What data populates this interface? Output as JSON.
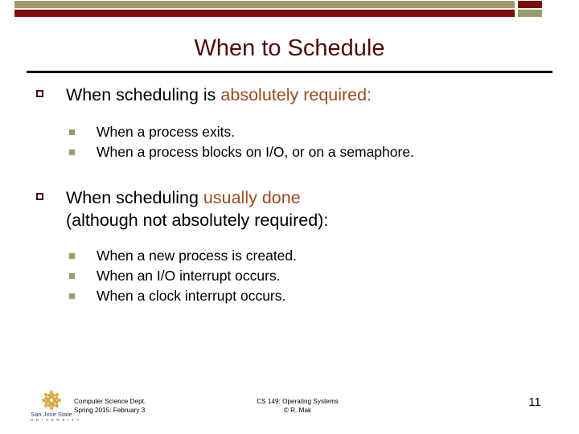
{
  "theme": {
    "banner_olive": "#9a9a6a",
    "banner_maroon": "#7d0c0c",
    "title_color": "#4d0b0b",
    "accent_color": "#9b4a23",
    "bullet1_color": "#4d0b0b",
    "bullet2_color": "#9a9a6a",
    "logo_gold": "#d8a93a",
    "logo_blue": "#1b3a6b"
  },
  "slide": {
    "title": "When to Schedule",
    "blocks": [
      {
        "lead_plain": "When scheduling is ",
        "lead_accent": "absolutely required:",
        "lead_tail": "",
        "sub": [
          "When a process exits.",
          "When a process blocks on I/O, or on a semaphore."
        ]
      },
      {
        "lead_plain": "When scheduling ",
        "lead_accent": "usually done",
        "lead_tail": "(although not absolutely required):",
        "sub": [
          "When a new process is created.",
          "When an I/O interrupt occurs.",
          "When a clock interrupt occurs."
        ]
      }
    ]
  },
  "footer": {
    "logo_name": "San José State",
    "logo_sub": "U N I V E R S I T Y",
    "left_line1": "Computer Science Dept.",
    "left_line2": "Spring 2015: February 3",
    "center_line1": "CS 149: Operating Systems",
    "center_line2": "© R. Mak",
    "page_number": "11"
  }
}
